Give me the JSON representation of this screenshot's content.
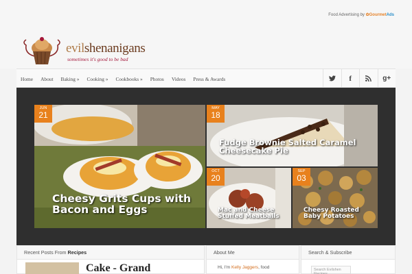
{
  "ad": {
    "text": "Food Advertising by",
    "brand_a": "Gourmet",
    "brand_b": "Ads"
  },
  "logo": {
    "title_prefix": "evil",
    "title_rest": "shenanigans",
    "tagline": "sometimes it's good to be bad"
  },
  "nav": {
    "items": [
      "Home",
      "About",
      "Baking »",
      "Cooking »",
      "Cookbooks »",
      "Photos",
      "Videos",
      "Press & Awards"
    ],
    "social": [
      {
        "icon": "twitter-icon",
        "glyph": "🐦"
      },
      {
        "icon": "facebook-icon",
        "glyph": "f"
      },
      {
        "icon": "rss-icon",
        "glyph": ")"
      },
      {
        "icon": "google-plus-icon",
        "glyph": "g+"
      }
    ]
  },
  "featured": [
    {
      "month": "JUN",
      "day": "21",
      "title": "Cheesy Grits Cups with Bacon and Eggs"
    },
    {
      "month": "MAY",
      "day": "18",
      "title": "Fudge Brownie Salted Caramel Cheesecake Pie"
    },
    {
      "month": "OCT",
      "day": "20",
      "title": "Mac and Cheese Stuffed Meatballs"
    },
    {
      "month": "SEP",
      "day": "03",
      "title": "Cheesy Roasted Baby Potatoes"
    }
  ],
  "bottom": {
    "recent_prefix": "Recent Posts From",
    "recent_category": "Recipes",
    "recent_post_title": "Cake - Grand",
    "about_title": "About Me",
    "about_text_prefix": "Hi, I'm",
    "about_name": "Kelly Jaggers",
    "about_text_suffix": ", food",
    "subscribe_title": "Search & Subscribe",
    "search_placeholder": "Search Evilshen Recipes"
  },
  "colors": {
    "accent": "#e8811d",
    "brand_text": "#6b3b1f",
    "tagline": "#a4173a"
  }
}
